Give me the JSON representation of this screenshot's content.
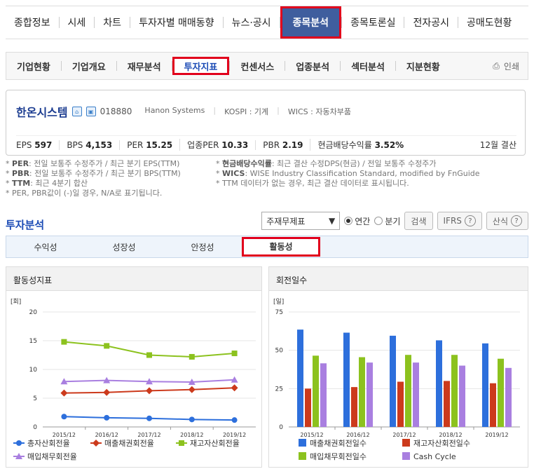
{
  "topnav": [
    "종합정보",
    "시세",
    "차트",
    "투자자별 매매동향",
    "뉴스·공시",
    "종목분석",
    "종목토론실",
    "전자공시",
    "공매도현황"
  ],
  "topnav_active": 5,
  "subnav": [
    "기업현황",
    "기업개요",
    "재무분석",
    "투자지표",
    "컨센서스",
    "업종분석",
    "섹터분석",
    "지분현황"
  ],
  "subnav_active": 3,
  "print_label": "인쇄",
  "company": {
    "name": "한온시스템",
    "code": "018880",
    "en_name": "Hanon Systems",
    "market": "KOSPI : 기계",
    "wics": "WICS : 자동차부품",
    "metrics": [
      {
        "label": "EPS",
        "value": "597"
      },
      {
        "label": "BPS",
        "value": "4,153"
      },
      {
        "label": "PER",
        "value": "15.25"
      },
      {
        "label": "업종PER",
        "value": "10.33"
      },
      {
        "label": "PBR",
        "value": "2.19"
      },
      {
        "label": "현금배당수익률",
        "value": "3.52%"
      }
    ],
    "settlement": "12월 결산"
  },
  "notes_left": [
    {
      "k": "PER",
      "v": ": 전일 보통주 수정주가 / 최근 분기 EPS(TTM)"
    },
    {
      "k": "PBR",
      "v": ": 전일 보통주 수정주가 / 최근 분기 BPS(TTM)"
    },
    {
      "k": "TTM",
      "v": ": 최근 4분기 합산"
    },
    {
      "k": "",
      "v": "PER, PBR값이 (-)일 경우, N/A로 표기됩니다."
    }
  ],
  "notes_right": [
    {
      "k": "현금배당수익률",
      "v": ": 최근 결산 수정DPS(현금) / 전일 보통주 수정주가"
    },
    {
      "k": "WICS",
      "v": ": WISE Industry Classification Standard, modified by FnGuide"
    },
    {
      "k": "",
      "v": "TTM 데이터가 없는 경우, 최근 결산 데이터로 표시됩니다."
    }
  ],
  "section_title": "투자분석",
  "controls": {
    "select_value": "주재무제표",
    "radio_annual": "연간",
    "radio_quarter": "분기",
    "search_btn": "검색",
    "ifrs_btn": "IFRS",
    "formula_btn": "산식"
  },
  "tabs": [
    "수익성",
    "성장성",
    "안정성",
    "활동성"
  ],
  "tabs_active": 3,
  "chart1_title": "활동성지표",
  "chart2_title": "회전일수",
  "chart_data": [
    {
      "type": "line",
      "title": "활동성지표",
      "ylabel": "[회]",
      "categories": [
        "2015/12",
        "2016/12",
        "2017/12",
        "2018/12",
        "2019/12"
      ],
      "ylim": [
        0,
        20
      ],
      "yticks": [
        0,
        5,
        10,
        15,
        20
      ],
      "series": [
        {
          "name": "총자산회전율",
          "color": "#2d6fdc",
          "marker": "circle",
          "values": [
            1.8,
            1.6,
            1.5,
            1.3,
            1.2
          ]
        },
        {
          "name": "매출채권회전율",
          "color": "#cc3a1c",
          "marker": "diamond",
          "values": [
            5.9,
            6.0,
            6.3,
            6.5,
            6.8
          ]
        },
        {
          "name": "재고자산회전율",
          "color": "#8cc21e",
          "marker": "square",
          "values": [
            14.8,
            14.1,
            12.5,
            12.2,
            12.8
          ]
        },
        {
          "name": "매입채무회전율",
          "color": "#a97fe0",
          "marker": "triangle",
          "values": [
            7.9,
            8.1,
            7.9,
            7.8,
            8.2
          ]
        }
      ]
    },
    {
      "type": "bar",
      "title": "회전일수",
      "ylabel": "[일]",
      "categories": [
        "2015/12",
        "2016/12",
        "2017/12",
        "2018/12",
        "2019/12"
      ],
      "ylim": [
        0,
        75
      ],
      "yticks": [
        0,
        25,
        50,
        75
      ],
      "series": [
        {
          "name": "매출채권회전일수",
          "color": "#2d6fdc",
          "values": [
            63.5,
            61.5,
            59.5,
            56.5,
            54.5
          ]
        },
        {
          "name": "재고자산회전일수",
          "color": "#cc3a1c",
          "values": [
            25,
            26,
            29.5,
            30,
            28.5
          ]
        },
        {
          "name": "매입채무회전일수",
          "color": "#8cc21e",
          "values": [
            46.5,
            45.5,
            47,
            47,
            44.5
          ]
        },
        {
          "name": "Cash Cycle",
          "color": "#a97fe0",
          "values": [
            41.5,
            42,
            42,
            40,
            38.5
          ]
        }
      ]
    }
  ]
}
